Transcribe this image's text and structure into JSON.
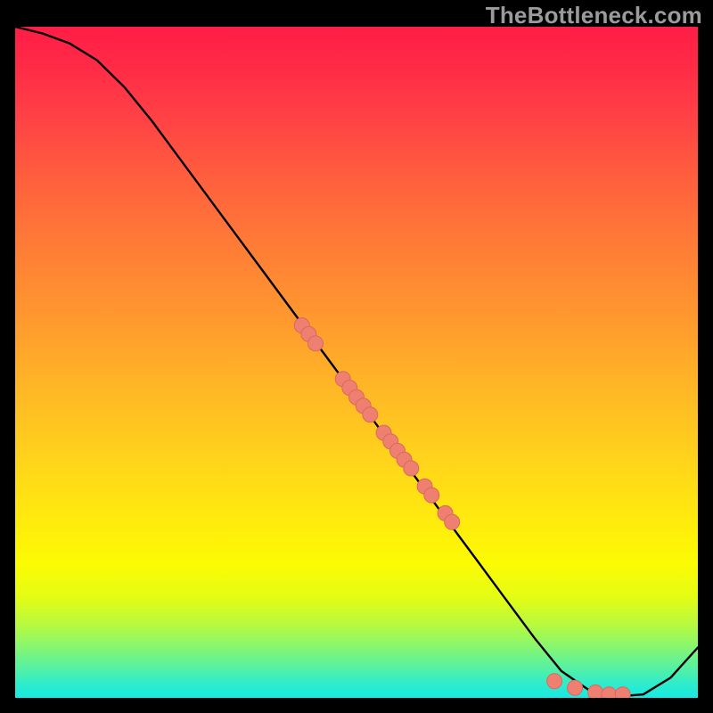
{
  "watermark": "TheBottleneck.com",
  "colors": {
    "curve": "#000000",
    "marker_fill": "#ef7f70",
    "marker_stroke": "#d96a5c",
    "frame": "#000000"
  },
  "chart_data": {
    "type": "line",
    "title": "",
    "xlabel": "",
    "ylabel": "",
    "xlim": [
      0,
      100
    ],
    "ylim": [
      0,
      100
    ],
    "grid": false,
    "legend": false,
    "series": [
      {
        "name": "curve",
        "x": [
          0,
          4,
          8,
          12,
          16,
          20,
          24,
          28,
          32,
          36,
          40,
          44,
          48,
          52,
          56,
          60,
          64,
          68,
          72,
          76,
          80,
          84,
          88,
          92,
          96,
          100
        ],
        "y": [
          100,
          99,
          97.5,
          95,
          91,
          86,
          80.5,
          75,
          69.5,
          64,
          58.5,
          53,
          47.5,
          42,
          36.5,
          31,
          25.5,
          20,
          14.5,
          9,
          4,
          1.2,
          0.2,
          0.5,
          3,
          7.5
        ]
      }
    ],
    "markers": {
      "name": "data-points",
      "x": [
        42,
        43,
        44,
        48,
        49,
        50,
        51,
        52,
        54,
        55,
        56,
        57,
        58,
        60,
        61,
        63,
        64,
        79,
        82,
        85,
        87,
        89
      ],
      "y": [
        55.5,
        54.2,
        52.8,
        47.5,
        46.2,
        44.8,
        43.5,
        42.2,
        39.5,
        38.2,
        36.8,
        35.5,
        34.2,
        31.5,
        30.2,
        27.5,
        26.2,
        2.5,
        1.5,
        0.8,
        0.5,
        0.5
      ]
    }
  }
}
